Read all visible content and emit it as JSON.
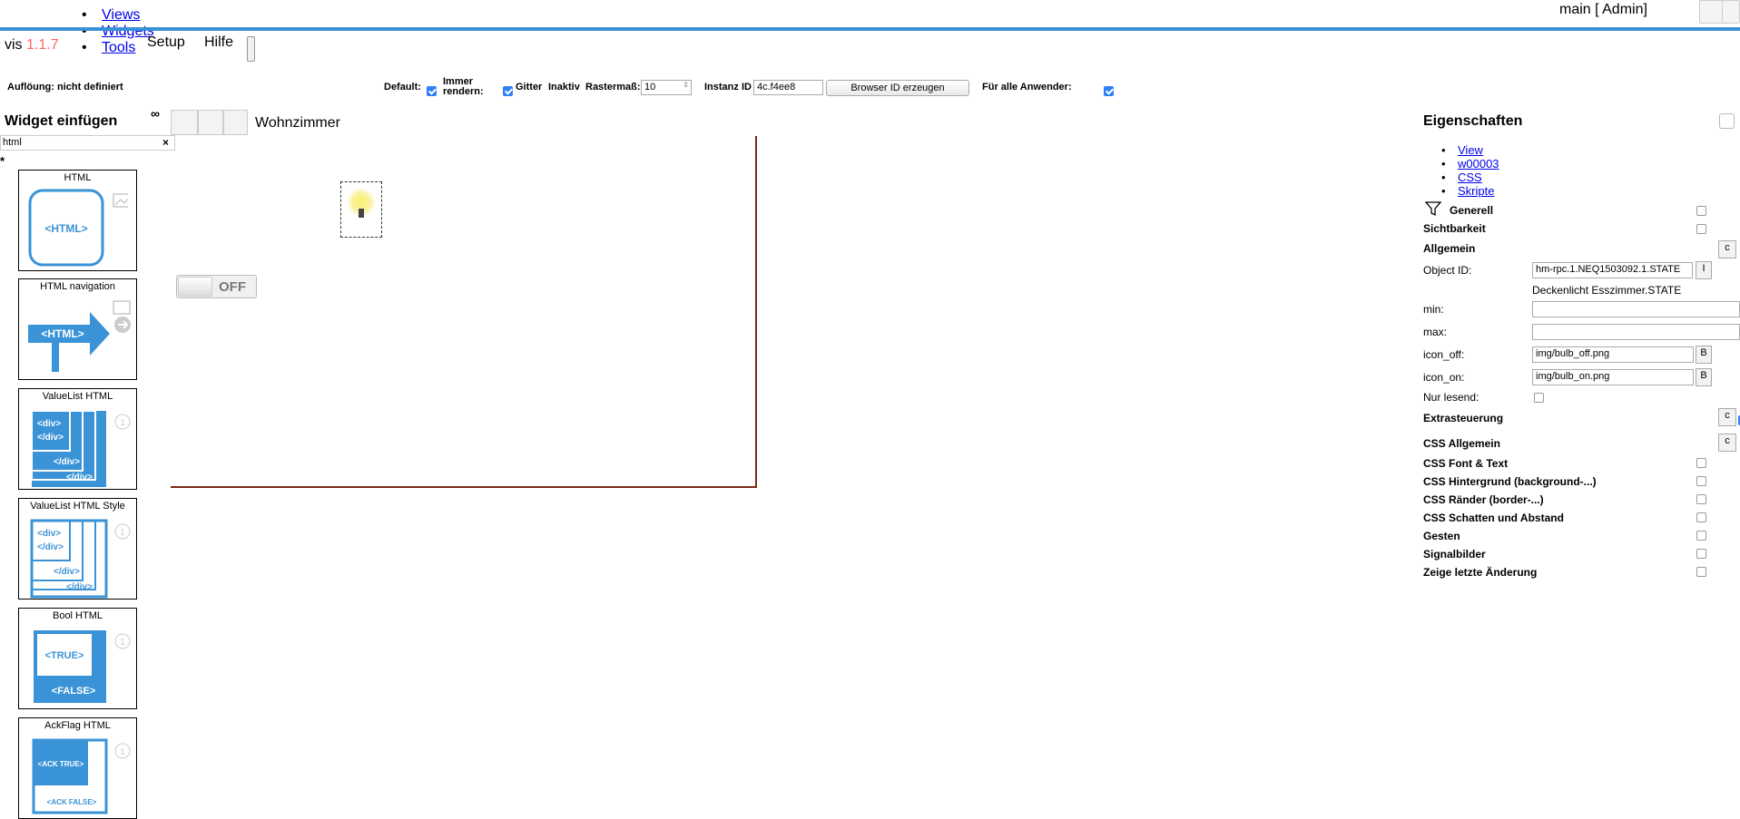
{
  "topnav": {
    "items": [
      "Views",
      "Widgets",
      "Tools"
    ]
  },
  "user": {
    "label": "main [ Admin]"
  },
  "brand": {
    "name": "vis",
    "version": "1.1.7"
  },
  "menu": {
    "setup": "Setup",
    "help": "Hilfe"
  },
  "toolbar": {
    "resolution": "Auflöung: nicht definiert",
    "default_label": "Default:",
    "default_checked": true,
    "always_render_label_1": "Immer",
    "always_render_label_2": "rendern:",
    "always_render_checked": true,
    "grid_label": "Gitter",
    "grid_value": "Inaktiv",
    "raster_label": "Rastermaß:",
    "raster_value": "10",
    "instance_label": "Instanz ID",
    "instance_value": "4c.f4ee8",
    "browser_id_button": "Browser ID erzeugen",
    "all_users_label": "Für alle Anwender:",
    "all_users_checked": true
  },
  "palette": {
    "title": "Widget einfügen",
    "filter_value": "html",
    "clear_icon": "×",
    "asterisk": "*",
    "widgets": [
      {
        "name": "HTML",
        "preview": "<HTML>"
      },
      {
        "name": "HTML navigation",
        "preview": "<HTML>"
      },
      {
        "name": "ValueList HTML",
        "preview_lines": [
          "<div>",
          "</div>",
          "</div>",
          "</div>"
        ]
      },
      {
        "name": "ValueList HTML Style",
        "preview_lines": [
          "<div>",
          "</div>",
          "</div>",
          "</div>"
        ]
      },
      {
        "name": "Bool HTML",
        "preview_lines": [
          "<TRUE>",
          "<FALSE>"
        ]
      },
      {
        "name": "AckFlag HTML",
        "preview_lines": [
          "<ACK TRUE>",
          "<ACK FALSE>"
        ]
      }
    ]
  },
  "views": {
    "binoculars": "∞",
    "active_view": "Wohnzimmer"
  },
  "canvas": {
    "toggle_label": "OFF"
  },
  "properties": {
    "title": "Eigenschaften",
    "links": [
      "View",
      "w00003",
      "CSS",
      "Skripte"
    ],
    "generell": "Generell",
    "sichtbarkeit": "Sichtbarkeit",
    "allgemein": "Allgemein",
    "object_id_label": "Object ID:",
    "object_id_value": "hm-rpc.1.NEQ1503092.1.STATE",
    "object_name": "Deckenlicht Esszimmer.STATE",
    "min_label": "min:",
    "max_label": "max:",
    "icon_off_label": "icon_off:",
    "icon_off_value": "img/bulb_off.png",
    "icon_on_label": "icon_on:",
    "icon_on_value": "img/bulb_on.png",
    "readonly_label": "Nur lesend:",
    "extrasteuerung": "Extrasteuerung",
    "extrasteuerung_checked": true,
    "css_allgemein": "CSS Allgemein",
    "css_font": "CSS Font & Text",
    "css_background": "CSS Hintergrund (background-...)",
    "css_border": "CSS Ränder (border-...)",
    "css_shadow": "CSS Schatten und Abstand",
    "gesten": "Gesten",
    "signalbilder": "Signalbilder",
    "last_change": "Zeige letzte Änderung",
    "small_btn_c": "c",
    "small_btn_i": "I",
    "small_btn_b": "B"
  }
}
